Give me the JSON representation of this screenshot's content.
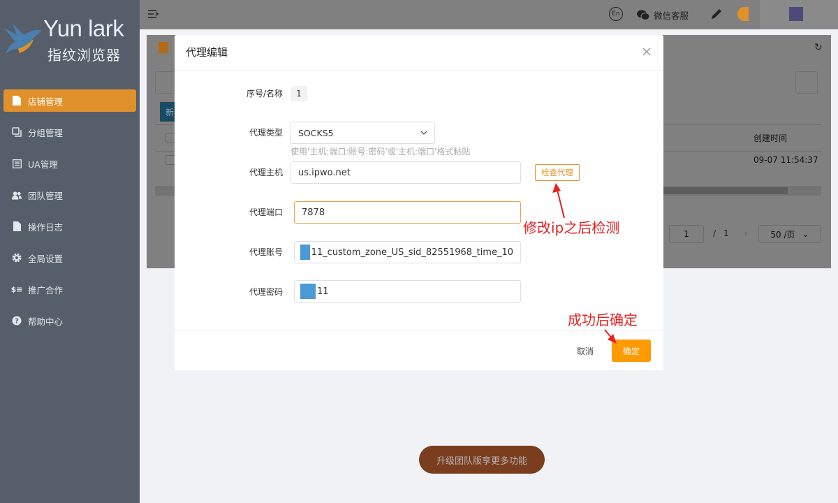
{
  "brand": {
    "name": "Yun lark",
    "subtitle": "指纹浏览器"
  },
  "sidebar": {
    "items": [
      {
        "label": "店铺管理",
        "icon": "document-icon",
        "active": true
      },
      {
        "label": "分组管理",
        "icon": "copy-icon",
        "active": false
      },
      {
        "label": "UA管理",
        "icon": "list-icon",
        "active": false
      },
      {
        "label": "团队管理",
        "icon": "team-icon",
        "active": false
      },
      {
        "label": "操作日志",
        "icon": "file-icon",
        "active": false
      },
      {
        "label": "全局设置",
        "icon": "gear-icon",
        "active": false
      },
      {
        "label": "推广合作",
        "icon": "dollar-icon",
        "active": false
      },
      {
        "label": "帮助中心",
        "icon": "question-icon",
        "active": false
      }
    ]
  },
  "topbar": {
    "lang": "En",
    "wechat_service": "微信客服"
  },
  "background_table": {
    "new_button_partial": "新",
    "created_time_header": "创建时间",
    "created_time_value": "09-07 11:54:37",
    "pager": {
      "current_page": "1",
      "separator": "/",
      "total_pages": "1",
      "page_size": "50 /页"
    }
  },
  "upgrade_button": "升级团队版享更多功能",
  "modal": {
    "title": "代理编辑",
    "fields": {
      "index_name": {
        "label": "序号/名称",
        "value": "1"
      },
      "proxy_type": {
        "label": "代理类型",
        "value": "SOCKS5",
        "hint": "使用'主机:端口:账号:密码'或'主机:端口'格式粘贴"
      },
      "proxy_host": {
        "label": "代理主机",
        "value": "us.ipwo.net"
      },
      "proxy_port": {
        "label": "代理端口",
        "value": "7878"
      },
      "proxy_account": {
        "label": "代理账号",
        "value": "11_custom_zone_US_sid_82551968_time_10"
      },
      "proxy_password": {
        "label": "代理密码",
        "value": "11"
      }
    },
    "check_proxy_button": "检查代理",
    "cancel_button": "取消",
    "confirm_button": "确定"
  },
  "annotations": {
    "check_note": "修改ip之后检测",
    "confirm_note": "成功后确定",
    "color": "#e62020"
  },
  "colors": {
    "accent": "#ff9a00",
    "sidebar_active": "#e0912a",
    "sidebar_bg": "#565e69"
  }
}
